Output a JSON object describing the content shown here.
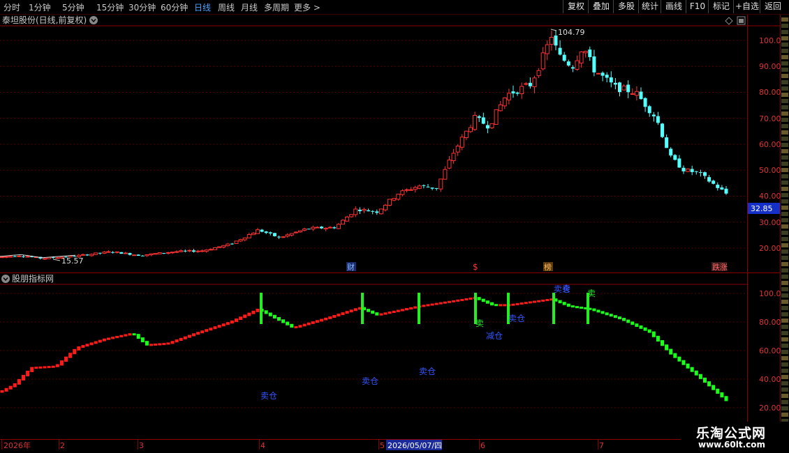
{
  "toolbar": {
    "periods": [
      "分时",
      "1分钟",
      "5分钟",
      "15分钟",
      "30分钟",
      "60分钟",
      "日线",
      "周线",
      "月线",
      "多周期",
      "更多 >"
    ],
    "active_period": "日线",
    "buttons": [
      "复权",
      "叠加",
      "多股",
      "统计",
      "画线",
      "F10",
      "标记",
      "+自选",
      "返回"
    ]
  },
  "main_panel": {
    "title": "泰坦股份(日线,前复权)",
    "price_axis": [
      "100.0",
      "90.00",
      "80.00",
      "70.00",
      "60.00",
      "50.00",
      "40.00",
      "30.00",
      "20.00"
    ],
    "current_price": "32.85",
    "high_label": "104.79",
    "low_label": "15.57",
    "event_markers": [
      "财",
      "$",
      "榜",
      "跌涨"
    ]
  },
  "indicator_panel": {
    "title": "股朋指标网",
    "axis": [
      "100.0",
      "80.00",
      "60.00",
      "40.00",
      "20.00"
    ],
    "signal_labels": [
      "卖",
      "减仓",
      "卖仓",
      "卖仓",
      "卖仓",
      "卖仓",
      "卖仓",
      "卖",
      "卖"
    ]
  },
  "date_axis": {
    "labels": [
      "2026年",
      "2",
      "3",
      "4",
      "5",
      "6",
      "7"
    ],
    "selected_date": "2026/05/07/四"
  },
  "watermark": {
    "name": "乐淘公式网",
    "url": "www.60lt.com"
  },
  "colors": {
    "up": "#ff3232",
    "down": "#54ffff",
    "ind_up": "#ff1a1a",
    "ind_down": "#1aff1a",
    "signal_bar": "#22ee22",
    "accent": "#4aa3ff"
  },
  "chart_data": {
    "type": "candlestick",
    "price_ylim": [
      15,
      108
    ],
    "indicator_ylim": [
      15,
      108
    ],
    "high": 104.79,
    "low": 15.57,
    "indicator_series_start": 30,
    "indicator_series_end": 23
  }
}
